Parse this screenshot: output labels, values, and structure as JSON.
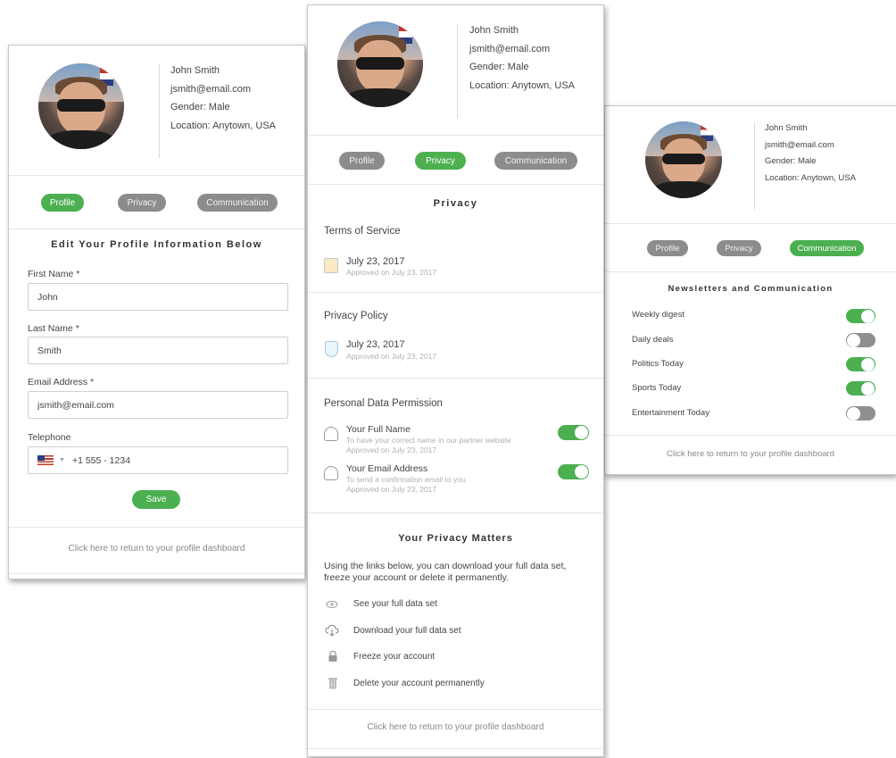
{
  "user": {
    "name": "John Smith",
    "email": "jsmith@email.com",
    "gender": "Gender: Male",
    "location": "Location: Anytown, USA"
  },
  "tabs": {
    "profile": "Profile",
    "privacy": "Privacy",
    "communication": "Communication"
  },
  "colors": {
    "accent": "#4caf50",
    "inactive": "#8c8c8c"
  },
  "profile": {
    "title": "Edit Your Profile Information Below",
    "first_name_label": "First Name *",
    "first_name_value": "John",
    "last_name_label": "Last Name *",
    "last_name_value": "Smith",
    "email_label": "Email Address *",
    "email_value": "jsmith@email.com",
    "telephone_label": "Telephone",
    "telephone_value": "+1  555 - 1234",
    "country_flag_icon": "us-flag-icon",
    "save_label": "Save"
  },
  "privacy": {
    "title": "Privacy",
    "tos": {
      "heading": "Terms of Service",
      "date": "July 23, 2017",
      "approved": "Approved on July 23, 2017"
    },
    "policy": {
      "heading": "Privacy Policy",
      "date": "July 23, 2017",
      "approved": "Approved on July 23, 2017"
    },
    "permissions": {
      "heading": "Personal Data Permission",
      "items": [
        {
          "title": "Your Full Name",
          "desc": "To have your correct name in our partner website",
          "approved": "Approved on July 23, 2017",
          "enabled": true
        },
        {
          "title": "Your Email Address",
          "desc": "To send a confirmation email to you",
          "approved": "Approved on July 23, 2017",
          "enabled": true
        }
      ]
    },
    "matters": {
      "title": "Your Privacy Matters",
      "text": "Using the links below, you can download your full data set, freeze your account or delete it permanently.",
      "actions": [
        {
          "label": "See your full data set",
          "icon": "eye-icon"
        },
        {
          "label": "Download your full data set",
          "icon": "cloud-download-icon"
        },
        {
          "label": "Freeze your account",
          "icon": "lock-icon"
        },
        {
          "label": "Delete your account permanently",
          "icon": "trash-icon"
        }
      ]
    }
  },
  "communication": {
    "title": "Newsletters and Communication",
    "items": [
      {
        "label": "Weekly digest",
        "enabled": true
      },
      {
        "label": "Daily deals",
        "enabled": false
      },
      {
        "label": "Politics Today",
        "enabled": true
      },
      {
        "label": "Sports Today",
        "enabled": true
      },
      {
        "label": "Entertainment Today",
        "enabled": false
      }
    ]
  },
  "footer": {
    "return_link": "Click here to return to your profile dashboard"
  }
}
